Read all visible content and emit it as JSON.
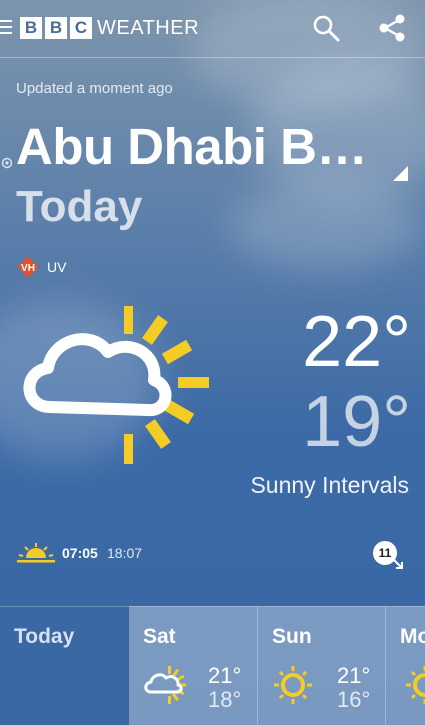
{
  "header": {
    "brand_letters": [
      "B",
      "B",
      "C"
    ],
    "brand_word": "WEATHER"
  },
  "status": {
    "updated": "Updated a moment ago"
  },
  "location": {
    "name": "Abu Dhabi B…"
  },
  "current": {
    "day": "Today",
    "uv_badge": "VH",
    "uv_label": "UV",
    "icon": "sunny-intervals-icon",
    "high": "22°",
    "low": "19°",
    "condition": "Sunny Intervals",
    "sunrise": "07:05",
    "sunset": "18:07",
    "wind_speed": "11"
  },
  "forecast": {
    "today_label": "Today",
    "days": [
      {
        "name": "Sat",
        "icon": "sunny-intervals-icon",
        "high": "21°",
        "low": "18°"
      },
      {
        "name": "Sun",
        "icon": "sunny-icon",
        "high": "21°",
        "low": "16°"
      },
      {
        "name": "Mon",
        "icon": "sunny-icon"
      }
    ]
  },
  "colors": {
    "sun_yellow": "#f4cc24",
    "uv_badge": "#e4512d",
    "brand_block_text": "#4b6c95"
  }
}
